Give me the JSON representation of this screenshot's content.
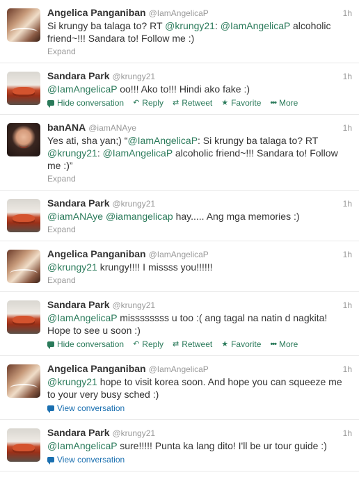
{
  "tweets": [
    {
      "fullname": "Angelica Panganiban",
      "username": "@IamAngelicaP",
      "time": "1h",
      "avatar": "actress-avatar",
      "text_parts": [
        {
          "t": "Si krungy ba talaga to? RT "
        },
        {
          "t": "@krungy21",
          "m": true
        },
        {
          "t": ": "
        },
        {
          "t": "@IamAngelicaP",
          "m": true
        },
        {
          "t": " alcoholic friend~!!! Sandara to! Follow me :)"
        }
      ],
      "footer": "Expand"
    },
    {
      "fullname": "Sandara Park",
      "username": "@krungy21",
      "time": "1h",
      "avatar": "crab-avatar",
      "text_parts": [
        {
          "t": "@IamAngelicaP",
          "m": true
        },
        {
          "t": " oo!!! Ako to!!! Hindi ako fake :)"
        }
      ],
      "actions": {
        "hide": "Hide conversation",
        "reply": "Reply",
        "retweet": "Retweet",
        "favorite": "Favorite",
        "more": "More"
      }
    },
    {
      "fullname": "banANA",
      "username": "@iamANAye",
      "time": "1h",
      "avatar": "girl-avatar",
      "text_parts": [
        {
          "t": "Yes ati, sha yan;)  “"
        },
        {
          "t": "@IamAngelicaP",
          "m": true
        },
        {
          "t": ": Si krungy ba talaga to? RT "
        },
        {
          "t": "@krungy21",
          "m": true
        },
        {
          "t": ": "
        },
        {
          "t": "@IamAngelicaP",
          "m": true
        },
        {
          "t": " alcoholic friend~!!! Sandara to! Follow me :)”"
        }
      ],
      "footer": "Expand"
    },
    {
      "fullname": "Sandara Park",
      "username": "@krungy21",
      "time": "1h",
      "avatar": "crab-avatar",
      "text_parts": [
        {
          "t": "@iamANAye",
          "m": true
        },
        {
          "t": " "
        },
        {
          "t": "@iamangelicap",
          "m": true
        },
        {
          "t": " hay..... Ang mga memories :)"
        }
      ],
      "footer": "Expand"
    },
    {
      "fullname": "Angelica Panganiban",
      "username": "@IamAngelicaP",
      "time": "1h",
      "avatar": "actress-avatar",
      "text_parts": [
        {
          "t": "@krungy21",
          "m": true
        },
        {
          "t": " krungy!!!! I missss you!!!!!!"
        }
      ],
      "footer": "Expand"
    },
    {
      "fullname": "Sandara Park",
      "username": "@krungy21",
      "time": "1h",
      "avatar": "crab-avatar",
      "text_parts": [
        {
          "t": "@IamAngelicaP",
          "m": true
        },
        {
          "t": " missssssss u too :(  ang tagal na natin d nagkita! Hope to see u soon :)"
        }
      ],
      "actions": {
        "hide": "Hide conversation",
        "reply": "Reply",
        "retweet": "Retweet",
        "favorite": "Favorite",
        "more": "More"
      }
    },
    {
      "fullname": "Angelica Panganiban",
      "username": "@IamAngelicaP",
      "time": "1h",
      "avatar": "actress-avatar",
      "text_parts": [
        {
          "t": "@krungy21",
          "m": true
        },
        {
          "t": " hope to visit korea soon. And hope you can squeeze me to your very busy sched :)"
        }
      ],
      "view": "View conversation"
    },
    {
      "fullname": "Sandara Park",
      "username": "@krungy21",
      "time": "1h",
      "avatar": "crab-avatar",
      "text_parts": [
        {
          "t": "@IamAngelicaP",
          "m": true
        },
        {
          "t": " sure!!!!! Punta ka lang dito! I'll be ur tour guide :)"
        }
      ],
      "view": "View conversation"
    }
  ],
  "colors": {
    "mention": "#2a7a5a",
    "link_blue": "#1a6fb0",
    "muted": "#999999"
  }
}
